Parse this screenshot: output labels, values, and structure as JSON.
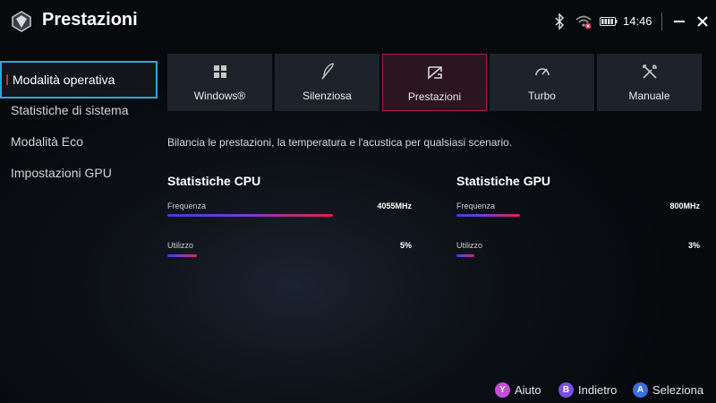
{
  "header": {
    "title": "Prestazioni",
    "time": "14:46",
    "icons": [
      "app-logo-icon",
      "bluetooth-icon",
      "wifi-icon",
      "battery-icon",
      "minimize-icon",
      "close-icon"
    ]
  },
  "sidebar": {
    "items": [
      {
        "label": "Modalità operativa"
      },
      {
        "label": "Statistiche di sistema"
      },
      {
        "label": "Modalità Eco"
      },
      {
        "label": "Impostazioni GPU"
      }
    ]
  },
  "modes": [
    {
      "label": "Windows®",
      "icon": "windows-icon"
    },
    {
      "label": "Silenziosa",
      "icon": "feather-icon"
    },
    {
      "label": "Prestazioni",
      "icon": "performance-icon"
    },
    {
      "label": "Turbo",
      "icon": "speedometer-icon"
    },
    {
      "label": "Manuale",
      "icon": "tools-icon"
    }
  ],
  "active_mode": "Prestazioni",
  "description": "Bilancia le prestazioni, la temperatura e l'acustica per qualsiasi scenario.",
  "cpu": {
    "title": "Statistiche CPU",
    "freq_label": "Frequenza",
    "freq_value": "4055MHz",
    "freq_fraction": 0.68,
    "usage_label": "Utilizzo",
    "usage_value": "5%",
    "usage_fraction": 0.05
  },
  "gpu": {
    "title": "Statistiche GPU",
    "freq_label": "Frequenza",
    "freq_value": "800MHz",
    "freq_fraction": 0.26,
    "usage_label": "Utilizzo",
    "usage_value": "3%",
    "usage_fraction": 0.03
  },
  "footer": {
    "help": {
      "key": "Y",
      "label": "Aiuto",
      "color": "#c34fd6"
    },
    "back": {
      "key": "B",
      "label": "Indietro",
      "color": "#7b4fe0"
    },
    "select": {
      "key": "A",
      "label": "Seleziona",
      "color": "#3a6fe0"
    }
  },
  "colors": {
    "accent": "#e0214a",
    "focus": "#2aa9d9"
  }
}
